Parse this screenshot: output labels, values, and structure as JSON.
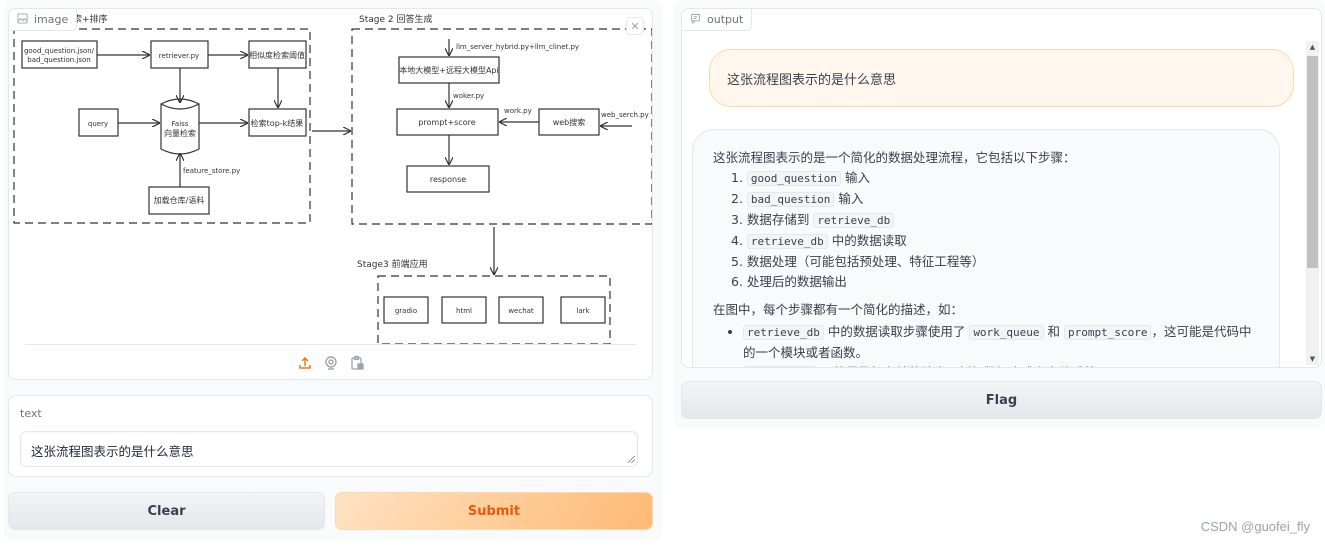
{
  "image_panel": {
    "label": "image",
    "close_symbol": "✕",
    "toolbar_icons": [
      "upload-icon",
      "webcam-icon",
      "clipboard-image-icon"
    ],
    "diagram": {
      "stage1_title": "索+排序",
      "stage2_title": "Stage 2 回答生成",
      "stage3_title": "Stage3 前端应用",
      "nodes": {
        "question_json_1": "good_question.json/",
        "question_json_2": "bad_question.json",
        "retriever": "retriever.py",
        "similarity": "相似度检索阈值",
        "query": "query",
        "faiss_1": "Faiss",
        "faiss_2": "向量检索",
        "topk": "检索top-k结果",
        "load_corpus": "加载仓库/语料",
        "llm": "本地大模型+远程大模型Api",
        "prompt_score": "prompt+score",
        "web_search": "web搜索",
        "response": "response",
        "gradio": "gradio",
        "html": "html",
        "wechat": "wechat",
        "lark": "lark"
      },
      "edge_labels": {
        "feature_store": "feature_store.py",
        "llm_server": "llm_server_hybrid.py+llm_clinet.py",
        "worker": "woker.py",
        "work": "work.py",
        "web_serch": "web_serch.py"
      }
    }
  },
  "text_input": {
    "label": "text",
    "value": "这张流程图表示的是什么意思"
  },
  "buttons": {
    "clear": "Clear",
    "submit": "Submit",
    "flag": "Flag"
  },
  "output_panel": {
    "label": "output",
    "user_message": "这张流程图表示的是什么意思",
    "bot_message": {
      "intro": "这张流程图表示的是一个简化的数据处理流程，它包括以下步骤：",
      "steps": [
        {
          "num": "1",
          "code": "good_question",
          "text": " 输入"
        },
        {
          "num": "2",
          "code": "bad_question",
          "text": " 输入"
        },
        {
          "num": "3",
          "pre": "数据存储到 ",
          "code": "retrieve_db"
        },
        {
          "num": "4",
          "code": "retrieve_db",
          "text": " 中的数据读取"
        },
        {
          "num": "5",
          "pre": "数据处理（可能包括预处理、特征工程等）"
        },
        {
          "num": "6",
          "pre": "处理后的数据输出"
        }
      ],
      "para2": "在图中，每个步骤都有一个简化的描述，如：",
      "bullet1": {
        "code1": "retrieve_db",
        "text1": " 中的数据读取步骤使用了 ",
        "code2": "work_queue",
        "text2": " 和 ",
        "code3": "prompt_score",
        "text3": "，这可能是代码中的一个模块或者函数。"
      },
      "bullet2": {
        "code1": "data_store",
        "text1": " 可能是数据存储的地方，例如数据库或者文件系统。"
      }
    }
  },
  "watermark": "CSDN @guofei_fly",
  "colors": {
    "accent": "#f97316",
    "submit_text": "#ea580c",
    "user_bubble_bg": "#fff7ed",
    "user_bubble_border": "#fed7aa"
  }
}
